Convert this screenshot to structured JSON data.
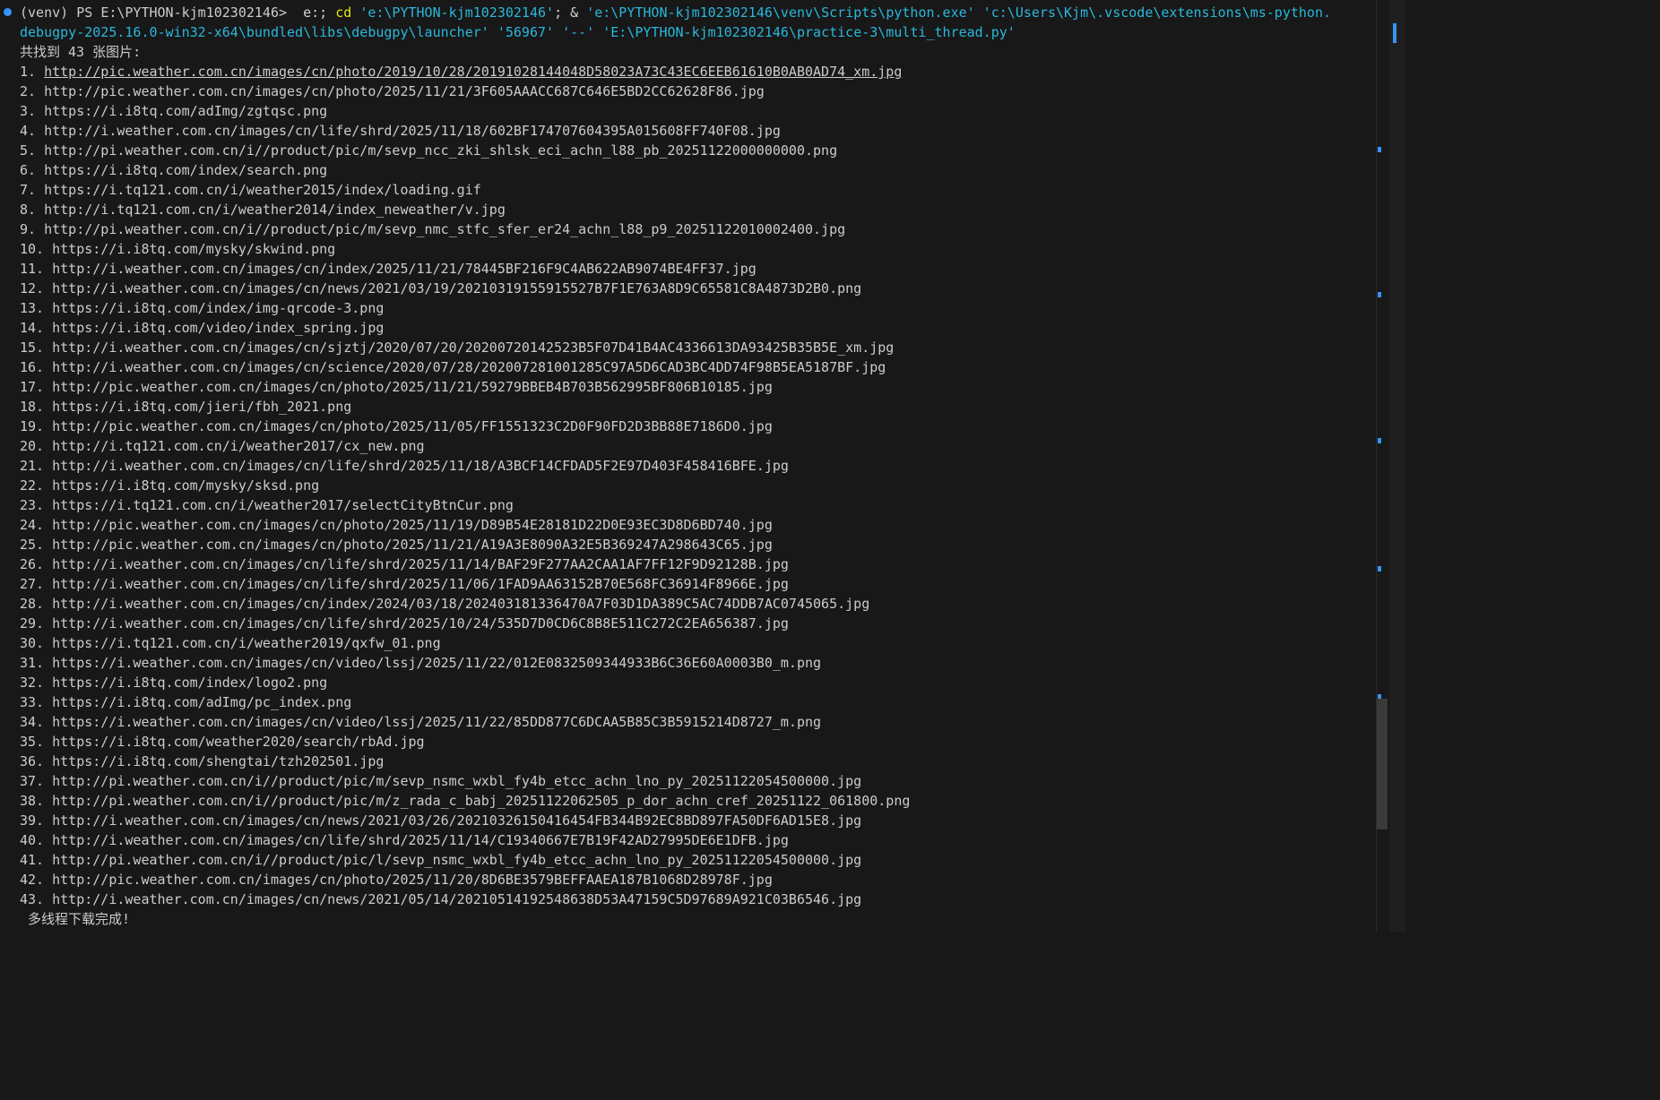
{
  "prompt": {
    "venv": "(venv)",
    "ps": "PS",
    "cwd": "E:\\PYTHON-kjm102302146>",
    "cmd_drive": "e:",
    "sep1": ";",
    "cd": "cd",
    "cd_arg": "'e:\\PYTHON-kjm102302146'",
    "sep2": "; &",
    "python": "'e:\\PYTHON-kjm102302146\\venv\\Scripts\\python.exe'",
    "ext_path": "'c:\\Users\\Kjm\\.vscode\\extensions\\ms-python.",
    "ext_path_cont": "debugpy-2025.16.0-win32-x64\\bundled\\libs\\debugpy\\launcher'",
    "port": "'56967'",
    "dashdash": "'--'",
    "script": "'E:\\PYTHON-kjm102302146\\practice-3\\multi_thread.py'"
  },
  "summary": "共找到 43 张图片:",
  "urls": [
    {
      "n": "1.",
      "url": "http://pic.weather.com.cn/images/cn/photo/2019/10/28/20191028144048D58023A73C43EC6EEB61610B0AB0AD74_xm.jpg"
    },
    {
      "n": "2.",
      "url": "http://pic.weather.com.cn/images/cn/photo/2025/11/21/3F605AAACC687C646E5BD2CC62628F86.jpg"
    },
    {
      "n": "3.",
      "url": "https://i.i8tq.com/adImg/zgtqsc.png"
    },
    {
      "n": "4.",
      "url": "http://i.weather.com.cn/images/cn/life/shrd/2025/11/18/602BF174707604395A015608FF740F08.jpg"
    },
    {
      "n": "5.",
      "url": "http://pi.weather.com.cn/i//product/pic/m/sevp_ncc_zki_shlsk_eci_achn_l88_pb_20251122000000000.png"
    },
    {
      "n": "6.",
      "url": "https://i.i8tq.com/index/search.png"
    },
    {
      "n": "7.",
      "url": "https://i.tq121.com.cn/i/weather2015/index/loading.gif"
    },
    {
      "n": "8.",
      "url": "http://i.tq121.com.cn/i/weather2014/index_neweather/v.jpg"
    },
    {
      "n": "9.",
      "url": "http://pi.weather.com.cn/i//product/pic/m/sevp_nmc_stfc_sfer_er24_achn_l88_p9_20251122010002400.jpg"
    },
    {
      "n": "10.",
      "url": "https://i.i8tq.com/mysky/skwind.png"
    },
    {
      "n": "11.",
      "url": "http://i.weather.com.cn/images/cn/index/2025/11/21/78445BF216F9C4AB622AB9074BE4FF37.jpg"
    },
    {
      "n": "12.",
      "url": "http://i.weather.com.cn/images/cn/news/2021/03/19/20210319155915527B7F1E763A8D9C65581C8A4873D2B0.png"
    },
    {
      "n": "13.",
      "url": "https://i.i8tq.com/index/img-qrcode-3.png"
    },
    {
      "n": "14.",
      "url": "https://i.i8tq.com/video/index_spring.jpg"
    },
    {
      "n": "15.",
      "url": "http://i.weather.com.cn/images/cn/sjztj/2020/07/20/20200720142523B5F07D41B4AC4336613DA93425B35B5E_xm.jpg"
    },
    {
      "n": "16.",
      "url": "http://i.weather.com.cn/images/cn/science/2020/07/28/202007281001285C97A5D6CAD3BC4DD74F98B5EA5187BF.jpg"
    },
    {
      "n": "17.",
      "url": "http://pic.weather.com.cn/images/cn/photo/2025/11/21/59279BBEB4B703B562995BF806B10185.jpg"
    },
    {
      "n": "18.",
      "url": "https://i.i8tq.com/jieri/fbh_2021.png"
    },
    {
      "n": "19.",
      "url": "http://pic.weather.com.cn/images/cn/photo/2025/11/05/FF1551323C2D0F90FD2D3BB88E7186D0.jpg"
    },
    {
      "n": "20.",
      "url": "http://i.tq121.com.cn/i/weather2017/cx_new.png"
    },
    {
      "n": "21.",
      "url": "http://i.weather.com.cn/images/cn/life/shrd/2025/11/18/A3BCF14CFDAD5F2E97D403F458416BFE.jpg"
    },
    {
      "n": "22.",
      "url": "https://i.i8tq.com/mysky/sksd.png"
    },
    {
      "n": "23.",
      "url": "https://i.tq121.com.cn/i/weather2017/selectCityBtnCur.png"
    },
    {
      "n": "24.",
      "url": "http://pic.weather.com.cn/images/cn/photo/2025/11/19/D89B54E28181D22D0E93EC3D8D6BD740.jpg"
    },
    {
      "n": "25.",
      "url": "http://pic.weather.com.cn/images/cn/photo/2025/11/21/A19A3E8090A32E5B369247A298643C65.jpg"
    },
    {
      "n": "26.",
      "url": "http://i.weather.com.cn/images/cn/life/shrd/2025/11/14/BAF29F277AA2CAA1AF7FF12F9D92128B.jpg"
    },
    {
      "n": "27.",
      "url": "http://i.weather.com.cn/images/cn/life/shrd/2025/11/06/1FAD9AA63152B70E568FC36914F8966E.jpg"
    },
    {
      "n": "28.",
      "url": "http://i.weather.com.cn/images/cn/index/2024/03/18/202403181336470A7F03D1DA389C5AC74DDB7AC0745065.jpg"
    },
    {
      "n": "29.",
      "url": "http://i.weather.com.cn/images/cn/life/shrd/2025/10/24/535D7D0CD6C8B8E511C272C2EA656387.jpg"
    },
    {
      "n": "30.",
      "url": "https://i.tq121.com.cn/i/weather2019/qxfw_01.png"
    },
    {
      "n": "31.",
      "url": "https://i.weather.com.cn/images/cn/video/lssj/2025/11/22/012E0832509344933B6C36E60A0003B0_m.png"
    },
    {
      "n": "32.",
      "url": "https://i.i8tq.com/index/logo2.png"
    },
    {
      "n": "33.",
      "url": "https://i.i8tq.com/adImg/pc_index.png"
    },
    {
      "n": "34.",
      "url": "https://i.weather.com.cn/images/cn/video/lssj/2025/11/22/85DD877C6DCAA5B85C3B5915214D8727_m.png"
    },
    {
      "n": "35.",
      "url": "https://i.i8tq.com/weather2020/search/rbAd.jpg"
    },
    {
      "n": "36.",
      "url": "https://i.i8tq.com/shengtai/tzh202501.jpg"
    },
    {
      "n": "37.",
      "url": "http://pi.weather.com.cn/i//product/pic/m/sevp_nsmc_wxbl_fy4b_etcc_achn_lno_py_20251122054500000.jpg"
    },
    {
      "n": "38.",
      "url": "http://pi.weather.com.cn/i//product/pic/m/z_rada_c_babj_20251122062505_p_dor_achn_cref_20251122_061800.png"
    },
    {
      "n": "39.",
      "url": "http://i.weather.com.cn/images/cn/news/2021/03/26/20210326150416454FB344B92EC8BD897FA50DF6AD15E8.jpg"
    },
    {
      "n": "40.",
      "url": "http://i.weather.com.cn/images/cn/life/shrd/2025/11/14/C19340667E7B19F42AD27995DE6E1DFB.jpg"
    },
    {
      "n": "41.",
      "url": "http://pi.weather.com.cn/i//product/pic/l/sevp_nsmc_wxbl_fy4b_etcc_achn_lno_py_20251122054500000.jpg"
    },
    {
      "n": "42.",
      "url": "http://pic.weather.com.cn/images/cn/photo/2025/11/20/8D6BE3579BEFFAAEA187B1068D28978F.jpg"
    },
    {
      "n": "43.",
      "url": "http://i.weather.com.cn/images/cn/news/2021/05/14/20210514192548638D53A47159C5D97689A921C03B6546.jpg"
    }
  ],
  "done": " 多线程下载完成!",
  "colors": {
    "background": "#181818",
    "text": "#cccccc",
    "command": "#e5e510",
    "string": "#29b8db",
    "accent": "#3794ff"
  }
}
